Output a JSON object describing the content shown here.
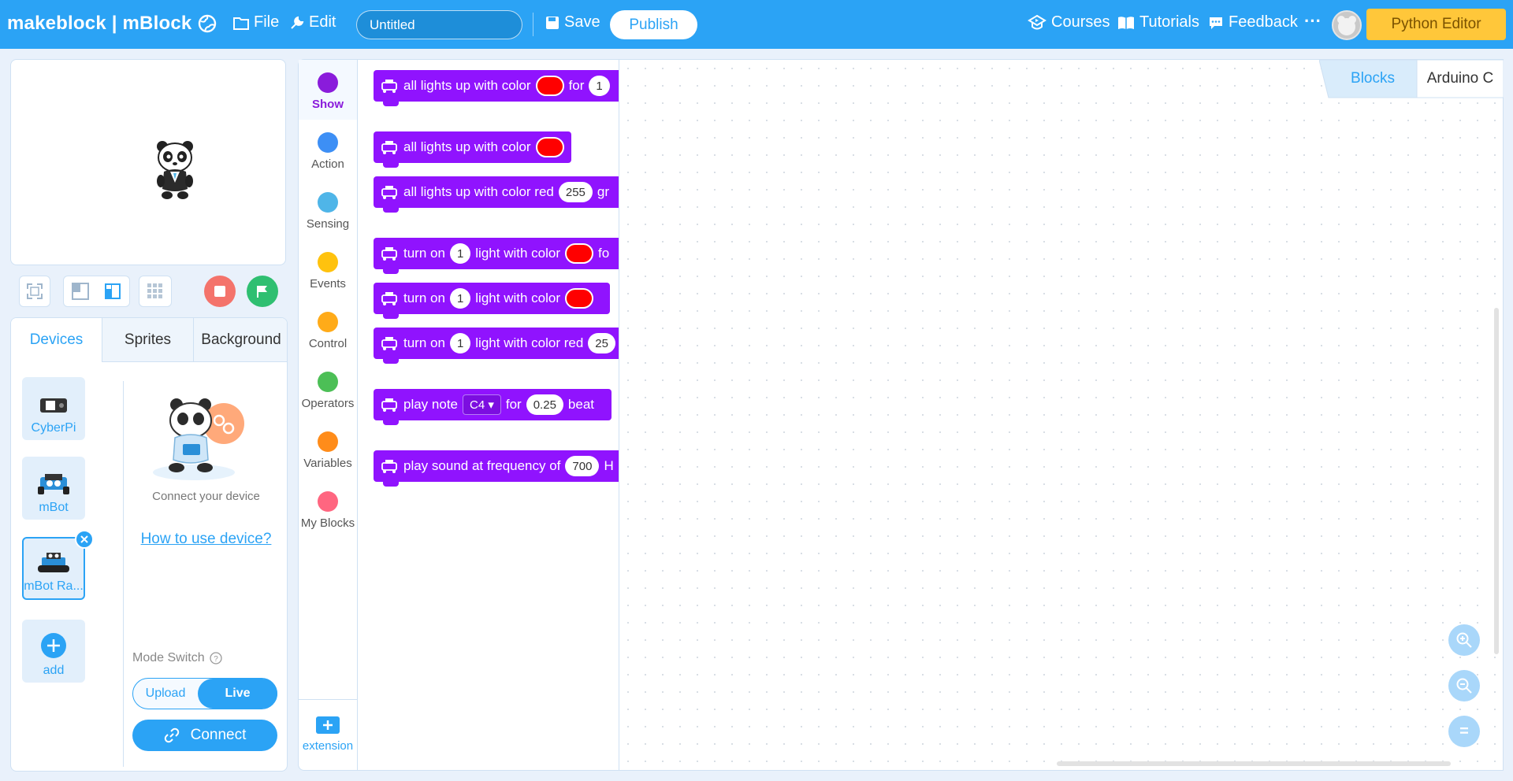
{
  "topbar": {
    "logo": "makeblock | mBlock",
    "file_label": "File",
    "edit_label": "Edit",
    "project_title": "Untitled",
    "save_label": "Save",
    "publish_label": "Publish",
    "courses_label": "Courses",
    "tutorials_label": "Tutorials",
    "feedback_label": "Feedback",
    "more_label": "···",
    "python_editor_label": "Python Editor"
  },
  "device_panel": {
    "tabs": [
      {
        "label": "Devices"
      },
      {
        "label": "Sprites"
      },
      {
        "label": "Background"
      }
    ],
    "devices": [
      {
        "label": "CyberPi"
      },
      {
        "label": "mBot"
      },
      {
        "label": "mBot Ra..."
      },
      {
        "label": "add"
      }
    ],
    "connect_hint": "Connect your device",
    "how_to_link": "How to use device?",
    "mode_switch_label": "Mode Switch",
    "mode_upload": "Upload",
    "mode_live": "Live",
    "connect_button": "Connect"
  },
  "categories": [
    {
      "label": "Show",
      "color": "#8a1cdb"
    },
    {
      "label": "Action",
      "color": "#3d8ff5"
    },
    {
      "label": "Sensing",
      "color": "#4fb5e8"
    },
    {
      "label": "Events",
      "color": "#ffc20e"
    },
    {
      "label": "Control",
      "color": "#ffab19"
    },
    {
      "label": "Operators",
      "color": "#4cbf56"
    },
    {
      "label": "Variables",
      "color": "#ff8c1a"
    },
    {
      "label": "My Blocks",
      "color": "#ff6680"
    }
  ],
  "extension_label": "extension",
  "blocks": {
    "b1": {
      "text1": "all lights up with color",
      "text2": "for",
      "num": "1"
    },
    "b2": {
      "text1": "all lights up with color"
    },
    "b3": {
      "text1": "all lights up with color red",
      "num": "255",
      "text2": "gr"
    },
    "b4": {
      "text1": "turn on",
      "num": "1",
      "text2": "light with color",
      "text3": "fo"
    },
    "b5": {
      "text1": "turn on",
      "num": "1",
      "text2": "light with color"
    },
    "b6": {
      "text1": "turn on",
      "num": "1",
      "text2": "light with color red",
      "num2": "25"
    },
    "b7": {
      "text1": "play note",
      "note": "C4 ▾",
      "text2": "for",
      "num": "0.25",
      "text3": "beat"
    },
    "b8": {
      "text1": "play sound at frequency of",
      "num": "700",
      "text2": "H"
    }
  },
  "workspace": {
    "tab_blocks": "Blocks",
    "tab_arduino": "Arduino C",
    "zoom_reset_label": "="
  },
  "colors": {
    "brand_blue": "#2ba3f5",
    "block_purple": "#9013fe",
    "python_yellow": "#ffc73a",
    "stop_red": "#f4736b",
    "go_green": "#2fbf71"
  }
}
